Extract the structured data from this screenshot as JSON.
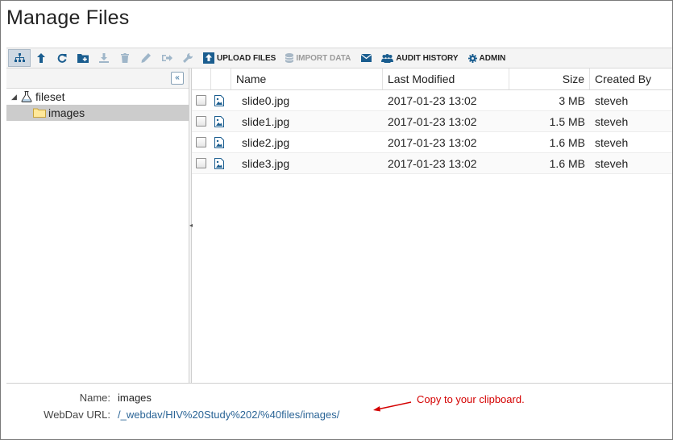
{
  "page": {
    "title": "Manage Files"
  },
  "toolbar": {
    "upload_label": "UPLOAD FILES",
    "import_label": "IMPORT DATA",
    "audit_label": "AUDIT HISTORY",
    "admin_label": "ADMIN"
  },
  "tree": {
    "root": {
      "label": "fileset",
      "icon": "flask-icon",
      "expanded": true
    },
    "children": [
      {
        "label": "images",
        "icon": "folder-icon",
        "selected": true
      }
    ]
  },
  "grid": {
    "columns": [
      "Name",
      "Last Modified",
      "Size",
      "Created By"
    ],
    "rows": [
      {
        "name": "slide0.jpg",
        "modified": "2017-01-23 13:02",
        "size": "3 MB",
        "created_by": "steveh"
      },
      {
        "name": "slide1.jpg",
        "modified": "2017-01-23 13:02",
        "size": "1.5 MB",
        "created_by": "steveh"
      },
      {
        "name": "slide2.jpg",
        "modified": "2017-01-23 13:02",
        "size": "1.6 MB",
        "created_by": "steveh"
      },
      {
        "name": "slide3.jpg",
        "modified": "2017-01-23 13:02",
        "size": "1.6 MB",
        "created_by": "steveh"
      }
    ]
  },
  "properties": {
    "name_label": "Name:",
    "name_value": "images",
    "webdav_label": "WebDav URL:",
    "webdav_value": "/_webdav/HIV%20Study%202/%40files/images/"
  },
  "annotation": {
    "text": "Copy to your clipboard.",
    "color": "#d40000"
  },
  "colors": {
    "accent": "#1a5d8f",
    "link": "#2a6496",
    "selected_row": "#cccccc"
  }
}
